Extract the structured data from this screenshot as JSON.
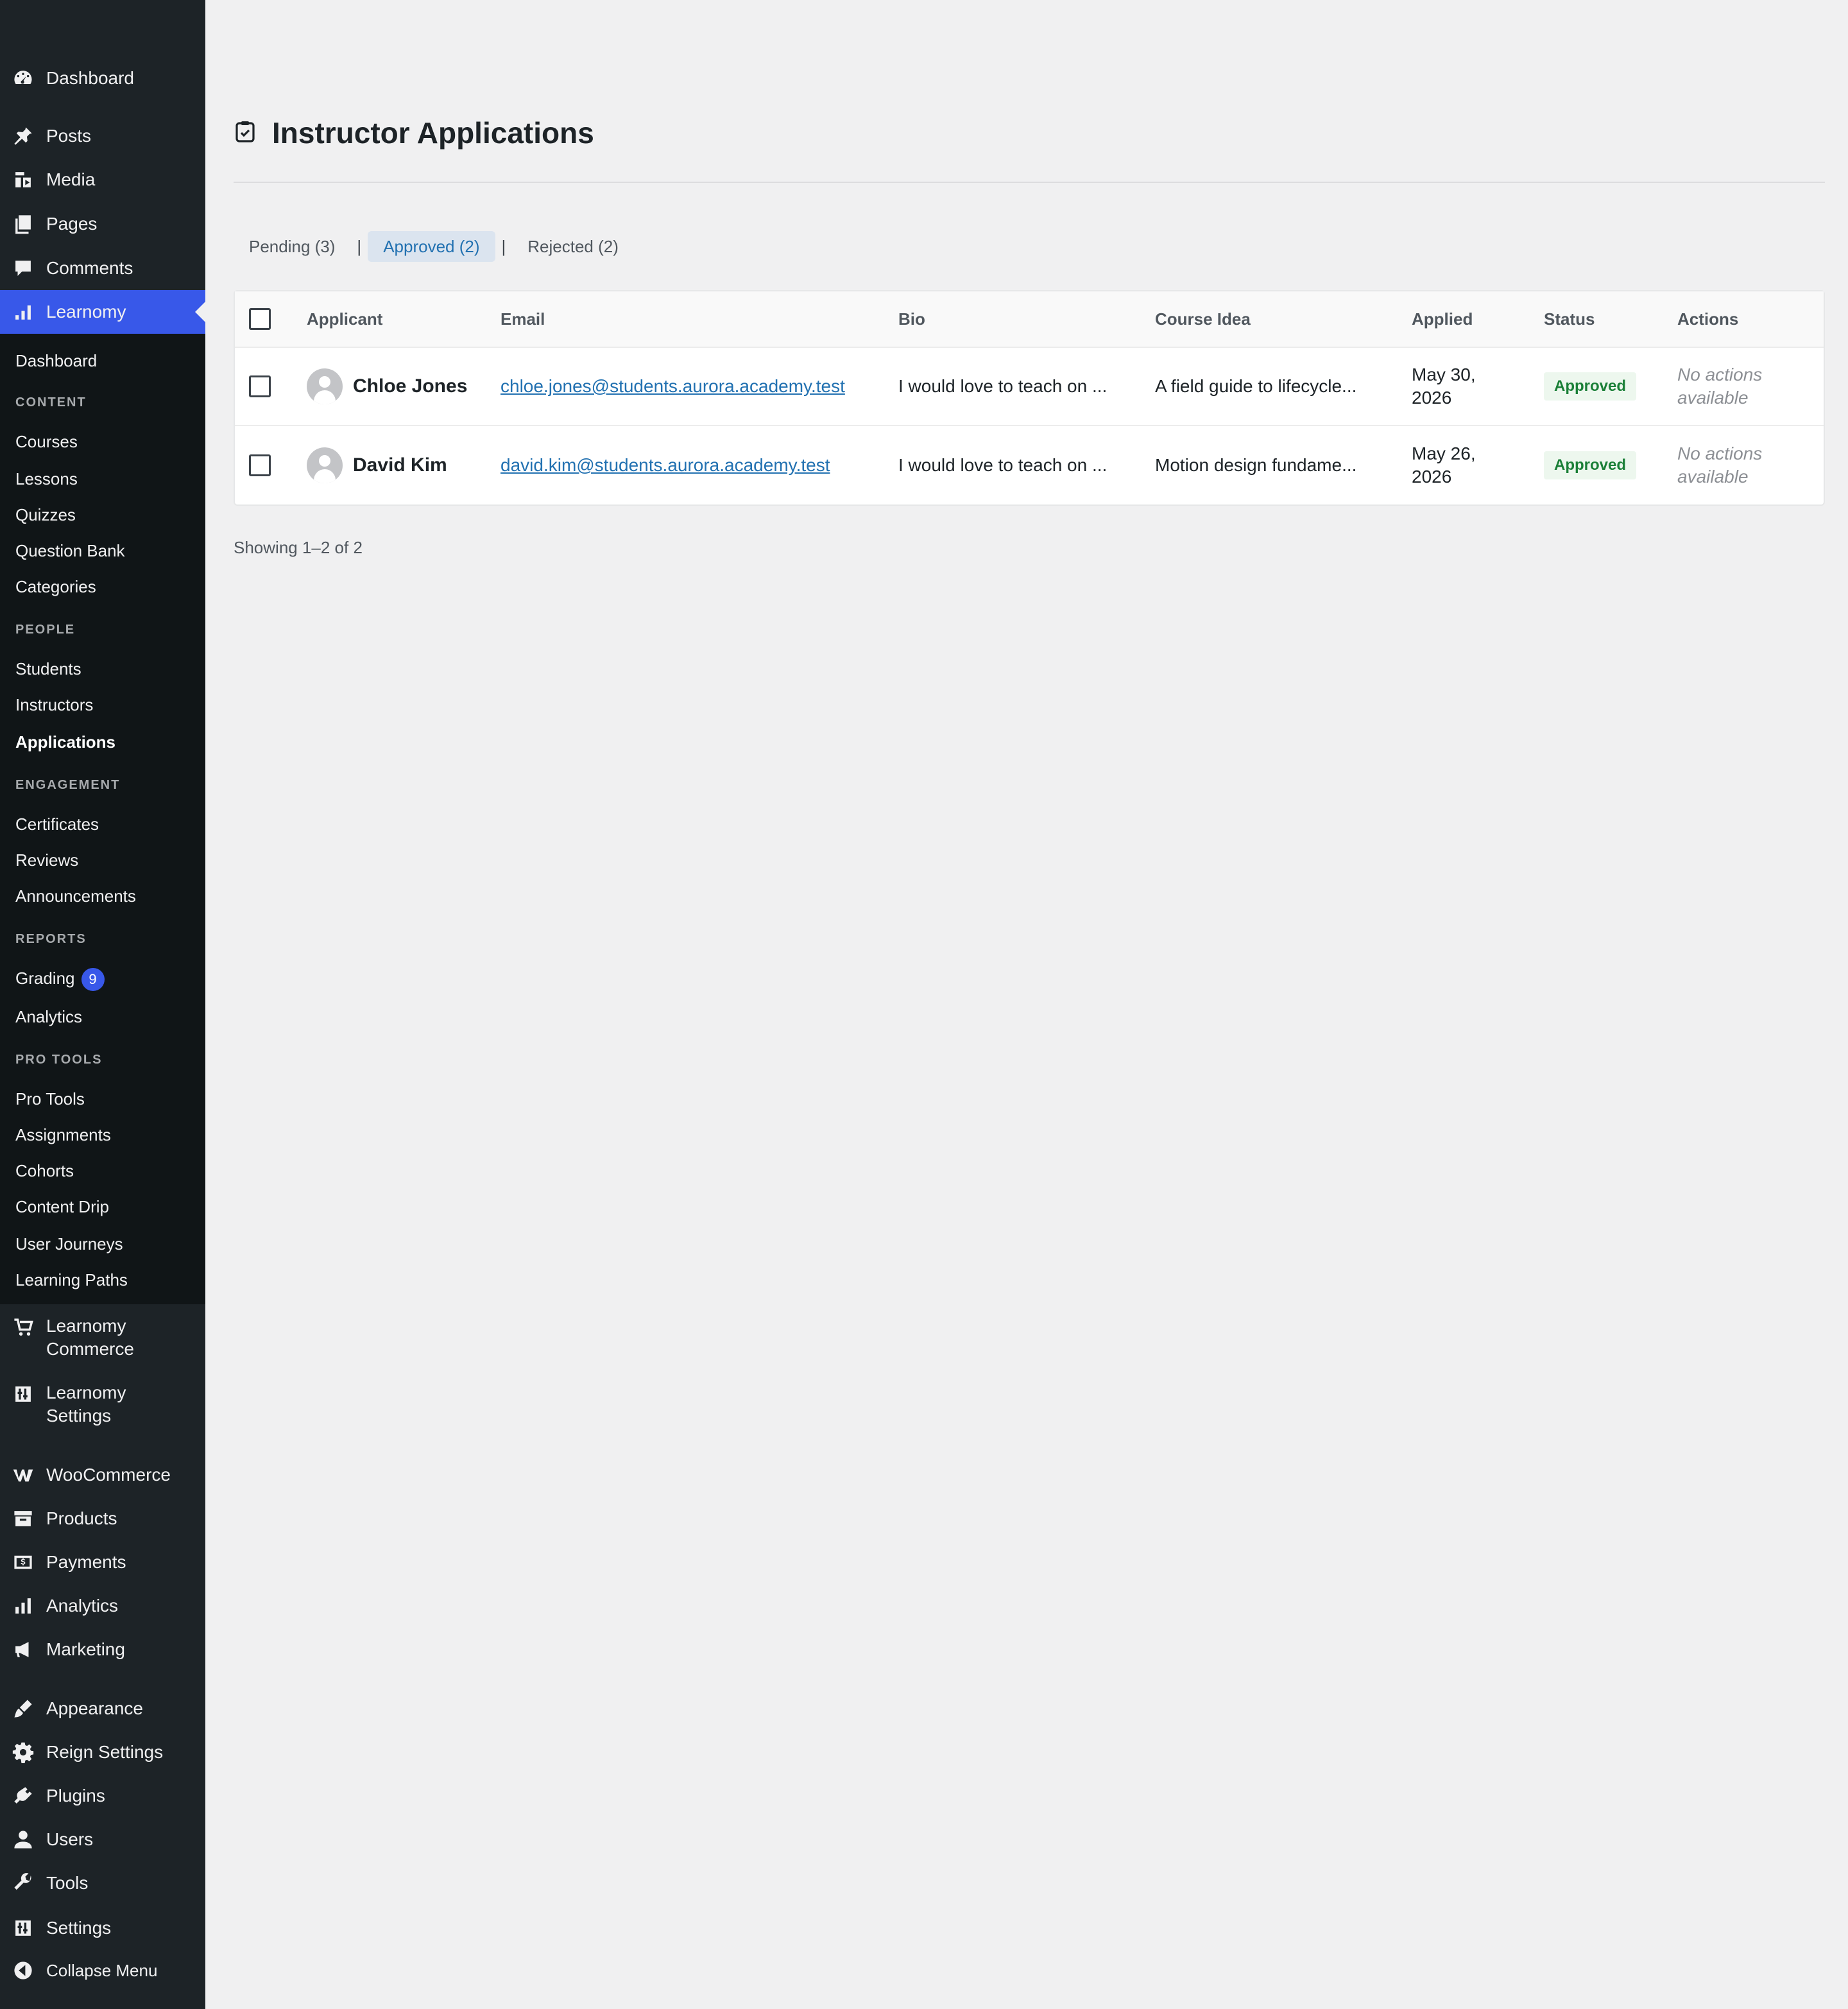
{
  "sidebar": {
    "top_items": [
      {
        "label": "Dashboard",
        "icon": "dashboard-icon"
      },
      {
        "label": "Posts",
        "icon": "pin-icon"
      },
      {
        "label": "Media",
        "icon": "media-icon"
      },
      {
        "label": "Pages",
        "icon": "pages-icon"
      },
      {
        "label": "Comments",
        "icon": "comment-icon"
      },
      {
        "label": "Learnomy",
        "icon": "bar-chart-icon"
      }
    ],
    "submenu": {
      "dashboard": "Dashboard",
      "sections": [
        {
          "heading": "CONTENT",
          "items": [
            "Courses",
            "Lessons",
            "Quizzes",
            "Question Bank",
            "Categories"
          ]
        },
        {
          "heading": "PEOPLE",
          "items": [
            "Students",
            "Instructors",
            "Applications"
          ]
        },
        {
          "heading": "ENGAGEMENT",
          "items": [
            "Certificates",
            "Reviews",
            "Announcements"
          ]
        },
        {
          "heading": "REPORTS",
          "items": [
            "Grading",
            "Analytics"
          ]
        },
        {
          "heading": "PRO TOOLS",
          "items": [
            "Pro Tools",
            "Assignments",
            "Cohorts",
            "Content Drip",
            "User Journeys",
            "Learning Paths"
          ]
        }
      ],
      "grading_badge": "9",
      "current": "Applications"
    },
    "lower_items": [
      {
        "label_line1": "Learnomy",
        "label_line2": "Commerce",
        "icon": "cart-icon"
      },
      {
        "label_line1": "Learnomy",
        "label_line2": "Settings",
        "icon": "settings-sliders-icon"
      },
      {
        "label": "WooCommerce",
        "icon": "woo-icon"
      },
      {
        "label": "Products",
        "icon": "archive-icon"
      },
      {
        "label": "Payments",
        "icon": "dollar-icon"
      },
      {
        "label": "Analytics",
        "icon": "bar-chart-icon"
      },
      {
        "label": "Marketing",
        "icon": "megaphone-icon"
      },
      {
        "label": "Appearance",
        "icon": "brush-icon"
      },
      {
        "label": "Reign Settings",
        "icon": "gear-icon"
      },
      {
        "label": "Plugins",
        "icon": "plug-icon"
      },
      {
        "label": "Users",
        "icon": "user-icon"
      },
      {
        "label": "Tools",
        "icon": "wrench-icon"
      },
      {
        "label": "Settings",
        "icon": "settings-sliders-icon"
      },
      {
        "label": "Collapse Menu",
        "icon": "collapse-icon"
      }
    ]
  },
  "page": {
    "title": "Instructor Applications",
    "title_icon": "clipboard-check-icon",
    "tabs": [
      {
        "label": "Pending (3)",
        "active": false
      },
      {
        "label": "Approved (2)",
        "active": true
      },
      {
        "label": "Rejected (2)",
        "active": false
      }
    ],
    "tab_separator": "|",
    "table": {
      "columns": [
        "Applicant",
        "Email",
        "Bio",
        "Course Idea",
        "Applied",
        "Status",
        "Actions"
      ],
      "rows": [
        {
          "name": "Chloe Jones",
          "email": "chloe.jones@students.aurora.academy.test",
          "bio": "I would love to teach on ...",
          "course_idea": "A field guide to lifecycle...",
          "applied_line1": "May 30,",
          "applied_line2": "2026",
          "status": "Approved",
          "actions_line1": "No actions",
          "actions_line2": "available"
        },
        {
          "name": "David Kim",
          "email": "david.kim@students.aurora.academy.test",
          "bio": "I would love to teach on ...",
          "course_idea": "Motion design fundame...",
          "applied_line1": "May 26,",
          "applied_line2": "2026",
          "status": "Approved",
          "actions_line1": "No actions",
          "actions_line2": "available"
        }
      ]
    },
    "showing": "Showing 1–2 of 2"
  },
  "colors": {
    "sidebar_bg": "#1d2327",
    "submenu_bg": "#101517",
    "accent": "#3858e9",
    "link": "#2271b1",
    "approved_bg": "#edf7ee",
    "approved_text": "#1a7f37",
    "page_bg": "#f0f0f1"
  }
}
